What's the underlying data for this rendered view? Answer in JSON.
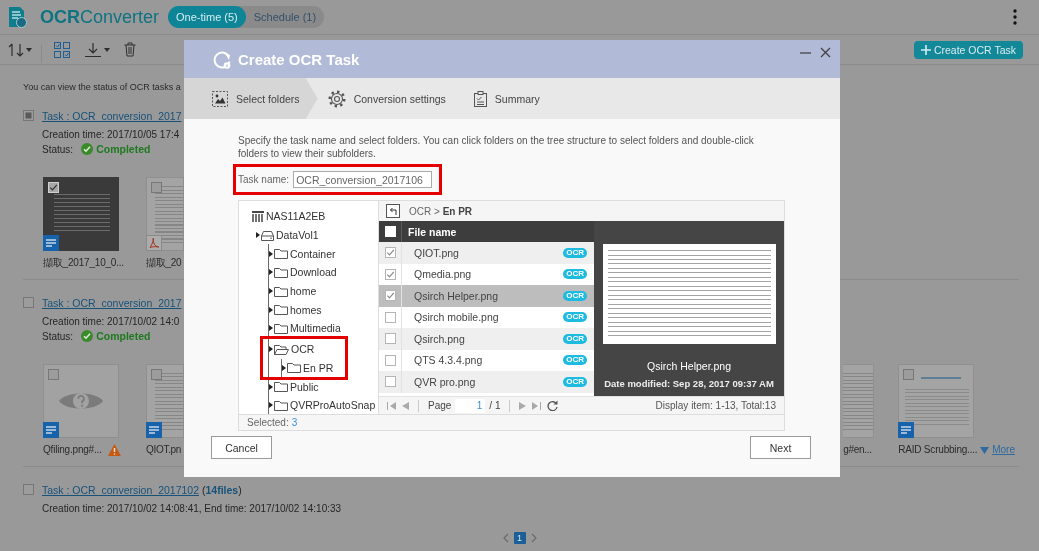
{
  "header": {
    "app_name": "**OCR**Converter",
    "tabs": [
      {
        "label": "One-time (5)",
        "selected": true
      },
      {
        "label": "Schedule (1)",
        "selected": false
      }
    ]
  },
  "toolbar": {
    "create_button": "Create OCR Task"
  },
  "intro": "You can view the status of OCR tasks a",
  "tasks": [
    {
      "checked": true,
      "title": "Task : OCR_conversion_2017",
      "created": "Creation time: 2017/10/05 17:4",
      "status_label": "Status:",
      "status": "Completed",
      "files": [
        {
          "name": "擷取_2017_10_0...",
          "kind": "dark",
          "badge": {
            "kind": "doc"
          },
          "checked": true,
          "warning": false
        },
        {
          "name": "擷取_20",
          "kind": "light",
          "badge": {
            "kind": "pdf"
          },
          "checked": false,
          "warning": false
        }
      ]
    },
    {
      "checked": false,
      "title": "Task : OCR_conversion_2017",
      "created": "Creation time: 2017/10/02 14:0",
      "status_label": "Status:",
      "status": "Completed",
      "files": [
        {
          "name": "Qfiling.png#...",
          "kind": "unknown",
          "badge": {
            "kind": "doc"
          },
          "checked": false,
          "warning": true
        },
        {
          "name": "QIOT.pn",
          "kind": "light",
          "badge": {
            "kind": "doc"
          },
          "checked": false,
          "warning": false
        }
      ],
      "files_right": [
        {
          "name": "g#en...",
          "kind": "light",
          "warning": false
        },
        {
          "name": "RAID Scrubbing....",
          "kind": "web",
          "badge": {
            "kind": "doc"
          },
          "checked": false,
          "warning": false
        }
      ],
      "more": "More"
    },
    {
      "checked": false,
      "title": "Task : OCR_conversion_2017102",
      "count": "(**14files**)",
      "created": "Creation time: 2017/10/02 14:08:41, End time: 2017/10/02 14:10:33"
    }
  ],
  "pagination": {
    "pages": [
      {
        "label": "1",
        "selected": true
      }
    ]
  },
  "dialog": {
    "title": "Create OCR Task",
    "steps": [
      {
        "label": "Select folders",
        "kind": "folders",
        "selected": true
      },
      {
        "label": "Conversion settings",
        "kind": "settings",
        "selected": false
      },
      {
        "label": "Summary",
        "kind": "summary",
        "selected": false
      }
    ],
    "description": "Specify the task name and select folders. You can click folders on the tree structure to select folders and double-click folders to view their subfolders.",
    "task_name": {
      "label": "Task name:",
      "value": "OCR_conversion_2017106",
      "highlighted": true
    },
    "tree": [
      {
        "label": "NAS11A2EB",
        "kind": "server",
        "children": [
          {
            "label": "DataVol1",
            "kind": "volume",
            "children": [
              {
                "label": "Container",
                "kind": "folder",
                "expanded": false,
                "highlighted": false
              },
              {
                "label": "Download",
                "kind": "folder",
                "expanded": false,
                "highlighted": false
              },
              {
                "label": "home",
                "kind": "folder",
                "expanded": false,
                "highlighted": false
              },
              {
                "label": "homes",
                "kind": "folder",
                "expanded": false,
                "highlighted": false
              },
              {
                "label": "Multimedia",
                "kind": "folder",
                "expanded": false,
                "highlighted": false
              },
              {
                "label": "OCR",
                "kind": "folder",
                "expanded": true,
                "highlighted": true,
                "children": [
                  {
                    "label": "En PR",
                    "kind": "folder",
                    "expanded": false,
                    "highlighted": false
                  }
                ]
              },
              {
                "label": "Public",
                "kind": "folder",
                "expanded": false,
                "highlighted": false
              },
              {
                "label": "QVRProAutoSnap",
                "kind": "folder",
                "expanded": false,
                "highlighted": false
              }
            ]
          }
        ]
      }
    ],
    "breadcrumb": "OCR > **En PR**",
    "files": {
      "header": "File name",
      "all_checked": false,
      "rows": [
        {
          "name": "QIOT.png",
          "checked": true,
          "selected": false,
          "badge": "OCR"
        },
        {
          "name": "Qmedia.png",
          "checked": true,
          "selected": false,
          "badge": "OCR"
        },
        {
          "name": "Qsirch Helper.png",
          "checked": true,
          "selected": true,
          "badge": "OCR"
        },
        {
          "name": "Qsirch mobile.png",
          "checked": false,
          "selected": false,
          "badge": "OCR"
        },
        {
          "name": "Qsirch.png",
          "checked": false,
          "selected": false,
          "badge": "OCR"
        },
        {
          "name": "QTS 4.3.4.png",
          "checked": false,
          "selected": false,
          "badge": "OCR"
        },
        {
          "name": "QVR pro.png",
          "checked": false,
          "selected": false,
          "badge": "OCR"
        }
      ]
    },
    "preview": {
      "caption": "Qsirch Helper.png",
      "modified": "Date modified: Sep 28, 2017 09:37 AM"
    },
    "pager": {
      "label": "Page",
      "page": "1",
      "of": "/ 1",
      "summary": "Display item: 1-13, Total:13"
    },
    "selection": {
      "label": "Selected:",
      "count": "3"
    },
    "buttons": [
      {
        "label": "Cancel"
      },
      {
        "label": "Next"
      }
    ]
  }
}
